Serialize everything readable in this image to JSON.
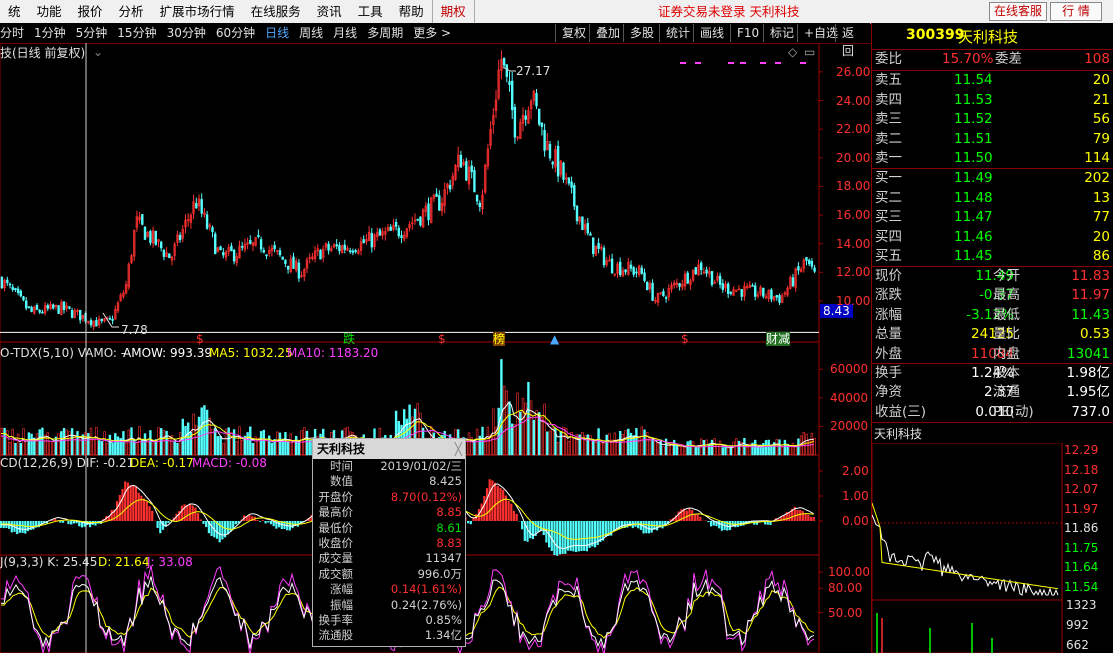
{
  "menu": {
    "items": [
      "统",
      "功能",
      "报价",
      "分析",
      "扩展市场行情",
      "在线服务",
      "资讯",
      "工具",
      "帮助"
    ],
    "futures": "期权",
    "login_status": "证券交易未登录 天利科技",
    "service_btn": "在线客服",
    "quote_btn": "行 情"
  },
  "periods": [
    "分时",
    "1分钟",
    "5分钟",
    "15分钟",
    "30分钟",
    "60分钟",
    "日线",
    "周线",
    "月线",
    "多周期",
    "更多 >"
  ],
  "active_period": "日线",
  "tools": [
    "复权",
    "叠加",
    "多股",
    "统计",
    "画线",
    "F10",
    "标记",
    "+自选",
    "返回"
  ],
  "chart_title": "技(日线 前复权)",
  "price_marks": {
    "high": "27.17",
    "low": "7.78",
    "current": "8.43"
  },
  "event_marks": [
    "$",
    "跌",
    "$",
    "榜",
    "$",
    "财减"
  ],
  "volume_legend": {
    "name": "O-TDX(5,10) VAMO: -",
    "amow": "AMOW: 993.39",
    "ma5": "MA5: 1032.25",
    "ma10": "MA10: 1183.20"
  },
  "macd_legend": {
    "name": "CD(12,26,9) DIF: -0.21",
    "dea": "DEA: -0.17",
    "macd": "MACD: -0.08"
  },
  "kdj_legend": {
    "name": "J(9,3,3) K: 25.45",
    "d": "D: 21.64",
    "j": "J: 33.08"
  },
  "price_axis": [
    "26.00",
    "24.00",
    "22.00",
    "20.00",
    "18.00",
    "16.00",
    "14.00",
    "12.00",
    "10.00"
  ],
  "volume_axis": [
    "60000",
    "40000",
    "20000"
  ],
  "macd_axis": [
    "2.00",
    "1.00",
    "0.00"
  ],
  "kdj_axis": [
    "100.00",
    "80.00",
    "50.00"
  ],
  "tooltip": {
    "title": "天利科技",
    "rows": [
      {
        "k": "时间",
        "v": "2019/01/02/三",
        "c": "#d0d0d0"
      },
      {
        "k": "数值",
        "v": "8.425",
        "c": "#d0d0d0"
      },
      {
        "k": "开盘价",
        "v": "8.70(0.12%)",
        "c": "#ff3030"
      },
      {
        "k": "最高价",
        "v": "8.85",
        "c": "#ff3030"
      },
      {
        "k": "最低价",
        "v": "8.61",
        "c": "#00e000"
      },
      {
        "k": "收盘价",
        "v": "8.83",
        "c": "#ff3030"
      },
      {
        "k": "成交量",
        "v": "11347",
        "c": "#d0d0d0"
      },
      {
        "k": "成交额",
        "v": "996.0万",
        "c": "#d0d0d0"
      },
      {
        "k": "涨幅",
        "v": "0.14(1.61%)",
        "c": "#ff3030"
      },
      {
        "k": "振幅",
        "v": "0.24(2.76%)",
        "c": "#d0d0d0"
      },
      {
        "k": "换手率",
        "v": "0.85%",
        "c": "#d0d0d0"
      },
      {
        "k": "流通股",
        "v": "1.34亿",
        "c": "#d0d0d0"
      }
    ]
  },
  "quote": {
    "code": "300399",
    "name": "天利科技",
    "weibi": {
      "label": "委比",
      "value": "15.70%",
      "label2": "委差",
      "value2": "108"
    },
    "asks": [
      {
        "label": "卖五",
        "price": "11.54",
        "vol": "20"
      },
      {
        "label": "卖四",
        "price": "11.53",
        "vol": "21"
      },
      {
        "label": "卖三",
        "price": "11.52",
        "vol": "56"
      },
      {
        "label": "卖二",
        "price": "11.51",
        "vol": "79"
      },
      {
        "label": "卖一",
        "price": "11.50",
        "vol": "114"
      }
    ],
    "bids": [
      {
        "label": "买一",
        "price": "11.49",
        "vol": "202"
      },
      {
        "label": "买二",
        "price": "11.48",
        "vol": "13"
      },
      {
        "label": "买三",
        "price": "11.47",
        "vol": "77"
      },
      {
        "label": "买四",
        "price": "11.46",
        "vol": "20"
      },
      {
        "label": "买五",
        "price": "11.45",
        "vol": "86"
      }
    ],
    "stats": [
      {
        "l1": "现价",
        "v1": "11.49",
        "c1": "#00ff00",
        "l2": "今开",
        "v2": "11.83",
        "c2": "#ff3030"
      },
      {
        "l1": "涨跌",
        "v1": "-0.37",
        "c1": "#00ff00",
        "l2": "最高",
        "v2": "11.97",
        "c2": "#ff3030"
      },
      {
        "l1": "涨幅",
        "v1": "-3.12%",
        "c1": "#00ff00",
        "l2": "最低",
        "v2": "11.43",
        "c2": "#00ff00"
      },
      {
        "l1": "总量",
        "v1": "24125",
        "c1": "#ffff00",
        "l2": "量比",
        "v2": "0.53",
        "c2": "#ffff00"
      },
      {
        "l1": "外盘",
        "v1": "11084",
        "c1": "#ff3030",
        "l2": "内盘",
        "v2": "13041",
        "c2": "#00ff00"
      }
    ],
    "stats2": [
      {
        "l1": "换手",
        "v1": "1.24%",
        "l2": "股本",
        "v2": "1.98亿"
      },
      {
        "l1": "净资",
        "v1": "2.37",
        "l2": "流通",
        "v2": "1.95亿"
      },
      {
        "l1": "收益(三)",
        "v1": "0.010",
        "l2": "PE(动)",
        "v2": "737.0"
      }
    ]
  },
  "mini_chart": {
    "title": "天利科技",
    "price_axis": [
      "12.29",
      "12.18",
      "12.07",
      "11.97",
      "11.86",
      "11.75",
      "11.64",
      "11.54"
    ],
    "volume_axis": [
      "1323",
      "992",
      "662"
    ]
  }
}
